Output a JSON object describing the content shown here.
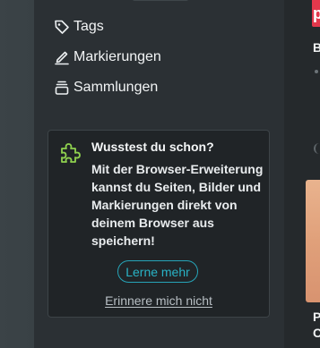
{
  "sidebar": {
    "items": [
      {
        "label": "Tags",
        "icon": "tag-icon"
      },
      {
        "label": "Markierungen",
        "icon": "highlighter-icon"
      },
      {
        "label": "Sammlungen",
        "icon": "collection-stack-icon"
      }
    ]
  },
  "tip": {
    "icon": "puzzle-piece-icon",
    "title": "Wusstest du schon?",
    "body": "Mit der Browser-Erweiterung kannst du Seiten, Bilder und Markierungen direkt von deinem Browser aus speichern!",
    "learn_more_label": "Lerne mehr",
    "dismiss_label": "Erinnere mich nicht"
  },
  "right_panel": {
    "logo_letter": "p",
    "cut_text_1": "B",
    "cut_text_2": "P",
    "cut_text_3": "C"
  },
  "colors": {
    "accent": "#26a4b8",
    "puzzle_icon": "#8fd14f",
    "logo": "#e3384c"
  }
}
